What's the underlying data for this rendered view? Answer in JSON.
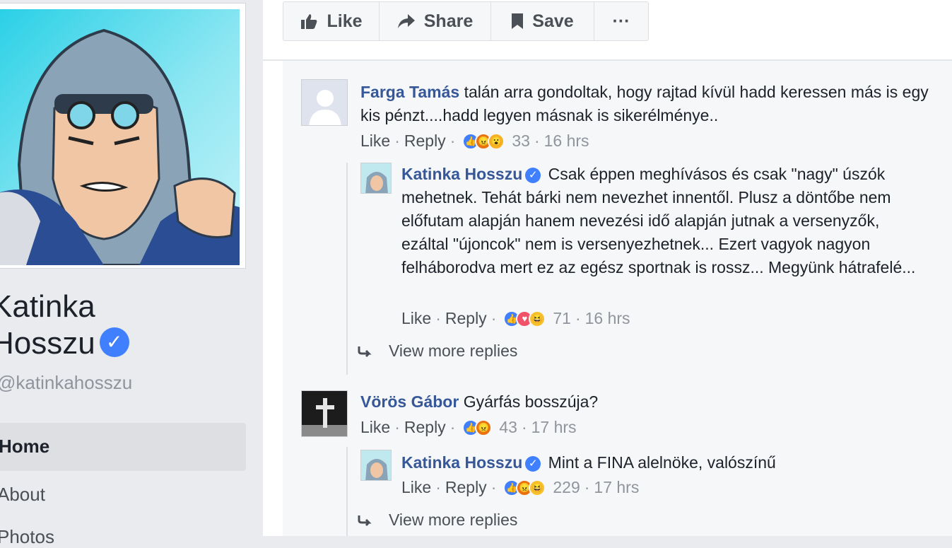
{
  "profile": {
    "name_line1": "Katinka",
    "name_line2": "Hosszu",
    "handle": "@katinkahosszu",
    "verified_icon": "verified-check-icon",
    "nav": [
      {
        "label": "Home",
        "active": true
      },
      {
        "label": "About",
        "active": false
      },
      {
        "label": "Photos",
        "active": false
      }
    ]
  },
  "action_bar": {
    "like_label": "Like",
    "share_label": "Share",
    "save_label": "Save",
    "more_label": "···"
  },
  "comments": [
    {
      "author": "Farga Tamás",
      "text": "talán arra gondoltak, hogy rajtad kívül hadd keressen más is egy kis pénzt....hadd legyen másnak is sikerélménye..",
      "like": "Like",
      "reply": "Reply",
      "reactions": [
        "like",
        "angry",
        "wow"
      ],
      "count": "33",
      "time": "16 hrs",
      "replies": [
        {
          "author": "Katinka Hosszu",
          "verified": true,
          "text": "Csak éppen meghívásos és csak \"nagy\" úszók mehetnek. Tehát bárki nem nevezhet innentől. Plusz a döntőbe nem előfutam alapján hanem nevezési idő alapján jutnak a versenyzők, ezáltal \"újoncok\" nem is versenyezhetnek... Ezert vagyok nagyon felháborodva mert ez az egész sportnak is rossz... Megyünk hátrafelé...",
          "like": "Like",
          "reply": "Reply",
          "reactions": [
            "like",
            "love",
            "haha"
          ],
          "count": "71",
          "time": "16 hrs"
        }
      ],
      "view_more": "View more replies"
    },
    {
      "author": "Vörös Gábor",
      "text": "Gyárfás bosszúja?",
      "like": "Like",
      "reply": "Reply",
      "reactions": [
        "like",
        "angry"
      ],
      "count": "43",
      "time": "17 hrs",
      "replies": [
        {
          "author": "Katinka Hosszu",
          "verified": true,
          "text": "Mint a FINA alelnöke, valószínű",
          "like": "Like",
          "reply": "Reply",
          "reactions": [
            "like",
            "angry",
            "haha"
          ],
          "count": "229",
          "time": "17 hrs"
        }
      ],
      "view_more": "View more replies"
    }
  ],
  "colors": {
    "link": "#365899",
    "verified": "#4080ff",
    "muted": "#90949c",
    "background": "#e9ebee",
    "comment_bg": "#f6f7f9"
  }
}
